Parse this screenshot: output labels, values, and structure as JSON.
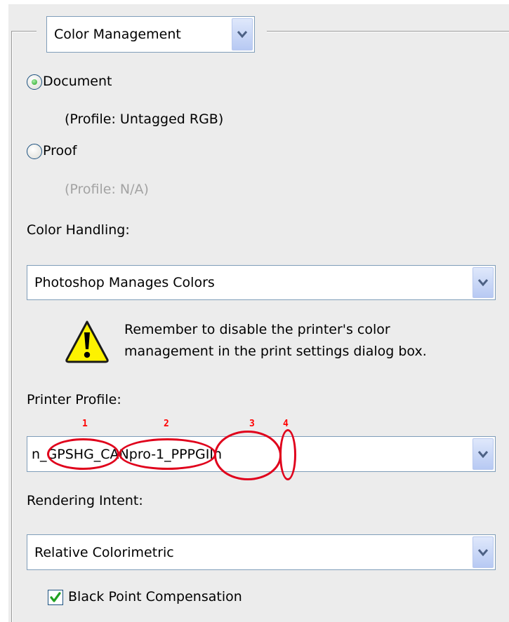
{
  "print_dialog": {
    "section_dropdown": {
      "value": "Color Management"
    },
    "source_space": {
      "document_label": "Document",
      "document_profile": "(Profile: Untagged RGB)",
      "proof_label": "Proof",
      "proof_profile": "(Profile: N/A)",
      "selected": "Document"
    },
    "color_handling": {
      "label": "Color Handling:",
      "value": "Photoshop Manages Colors"
    },
    "warning": {
      "line1": "Remember to disable the printer's color",
      "line2": "management in the print settings dialog box."
    },
    "printer_profile": {
      "label": "Printer Profile:",
      "value": "n_GPSHG_CANpro-1_PPPGIIn",
      "annotations": [
        "1",
        "2",
        "3",
        "4"
      ]
    },
    "rendering_intent": {
      "label": "Rendering Intent:",
      "value": "Relative Colorimetric"
    },
    "black_point": {
      "label": "Black Point Compensation",
      "checked": true
    }
  },
  "colors": {
    "annotation_red": "#e0001b",
    "dropdown_border": "#7f9db9",
    "disabled_text": "#a3a3a3"
  }
}
